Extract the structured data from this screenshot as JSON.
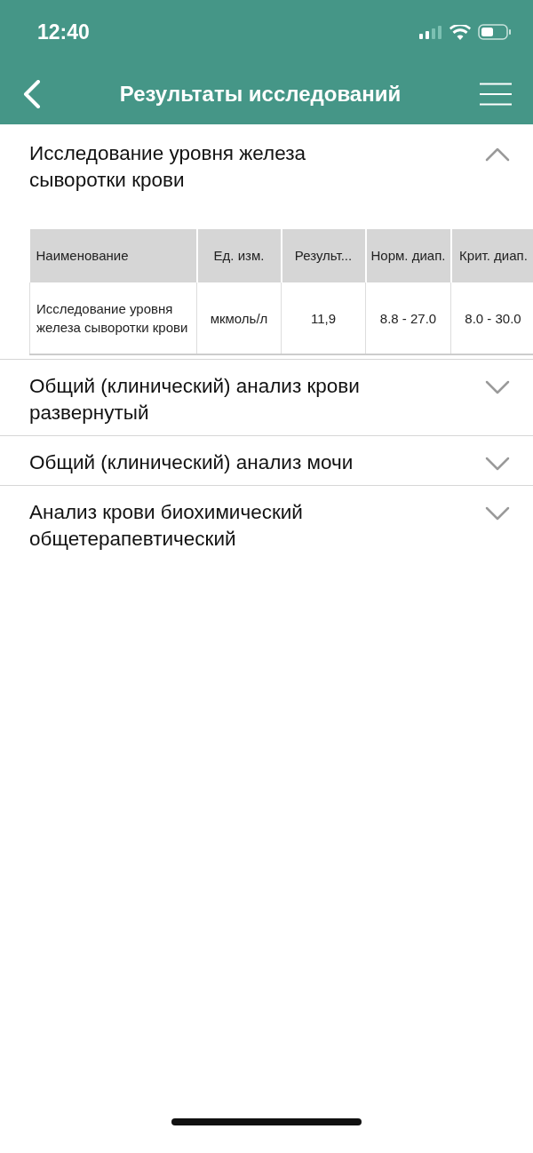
{
  "status_bar": {
    "time": "12:40"
  },
  "nav_bar": {
    "title": "Результаты исследований"
  },
  "sections": [
    {
      "title": "Исследование уровня железа сыворотки крови",
      "expanded": true,
      "table": {
        "columns": [
          "Наименование",
          "Ед. изм.",
          "Результ...",
          "Норм. диап.",
          "Крит. диап."
        ],
        "rows": [
          [
            "Исследование уровня железа сыворотки крови",
            "мкмоль/л",
            "11,9",
            "8.8 - 27.0",
            "8.0 - 30.0"
          ]
        ]
      }
    },
    {
      "title": "Общий (клинический) анализ крови развернутый",
      "expanded": false
    },
    {
      "title": "Общий (клинический) анализ мочи",
      "expanded": false
    },
    {
      "title": "Анализ крови биохимический общетерапевтический",
      "expanded": false
    }
  ]
}
